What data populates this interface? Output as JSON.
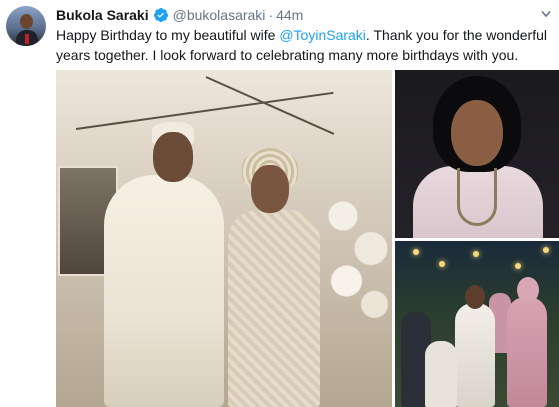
{
  "tweet": {
    "author_name": "Bukola Saraki",
    "handle": "@bukolasaraki",
    "separator": "·",
    "time": "44m",
    "text_before": "Happy Birthday to my beautiful wife ",
    "mention": "@ToyinSaraki",
    "text_after": ". Thank you for the wonderful years together. I look forward to celebrating many more birthdays with you."
  },
  "icons": {
    "verified": "verified-badge-icon",
    "more": "chevron-down-icon"
  },
  "colors": {
    "link": "#1da1f2",
    "verified": "#1da1f2",
    "muted": "#657786"
  }
}
